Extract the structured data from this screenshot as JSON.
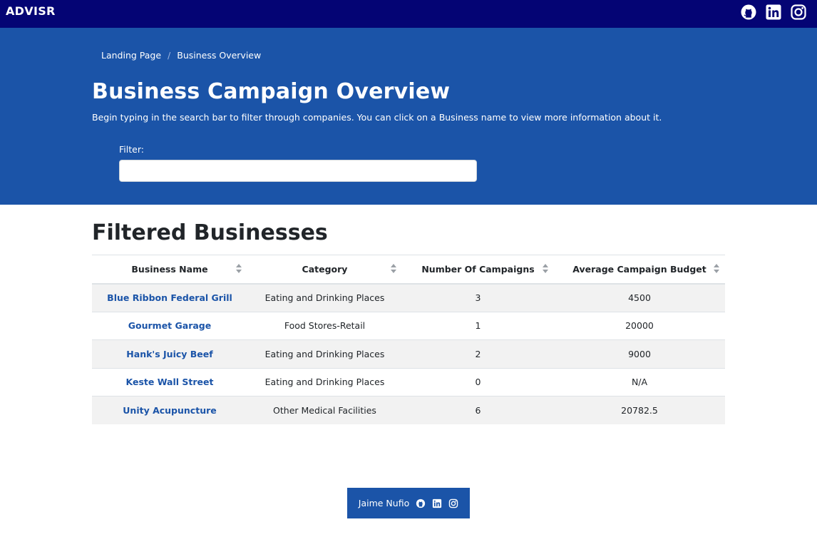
{
  "navbar": {
    "brand": "ADVISR",
    "icons": [
      "github-icon",
      "linkedin-icon",
      "instagram-icon"
    ]
  },
  "breadcrumb": {
    "items": [
      "Landing Page",
      "Business Overview"
    ],
    "separator": "/"
  },
  "hero": {
    "title": "Business Campaign Overview",
    "description": "Begin typing in the search bar to filter through companies. You can click on a Business name to view more information about it.",
    "filter_label": "Filter:",
    "filter_value": "",
    "filter_placeholder": ""
  },
  "section": {
    "title": "Filtered Businesses"
  },
  "table": {
    "headers": [
      "Business Name",
      "Category",
      "Number Of Campaigns",
      "Average Campaign Budget"
    ],
    "rows": [
      [
        "Blue Ribbon Federal Grill",
        "Eating and Drinking Places",
        "3",
        "4500"
      ],
      [
        "Gourmet Garage",
        "Food Stores-Retail",
        "1",
        "20000"
      ],
      [
        "Hank's Juicy Beef",
        "Eating and Drinking Places",
        "2",
        "9000"
      ],
      [
        "Keste Wall Street",
        "Eating and Drinking Places",
        "0",
        "N/A"
      ],
      [
        "Unity Acupuncture",
        "Other Medical Facilities",
        "6",
        "20782.5"
      ]
    ]
  },
  "footer": {
    "name": "Jaime Nufio",
    "icons": [
      "github-icon",
      "linkedin-icon",
      "instagram-icon"
    ]
  },
  "colors": {
    "navbar": "#040474",
    "hero": "#1b54a8",
    "link": "#1b54a8",
    "stripe": "#f2f2f2"
  }
}
